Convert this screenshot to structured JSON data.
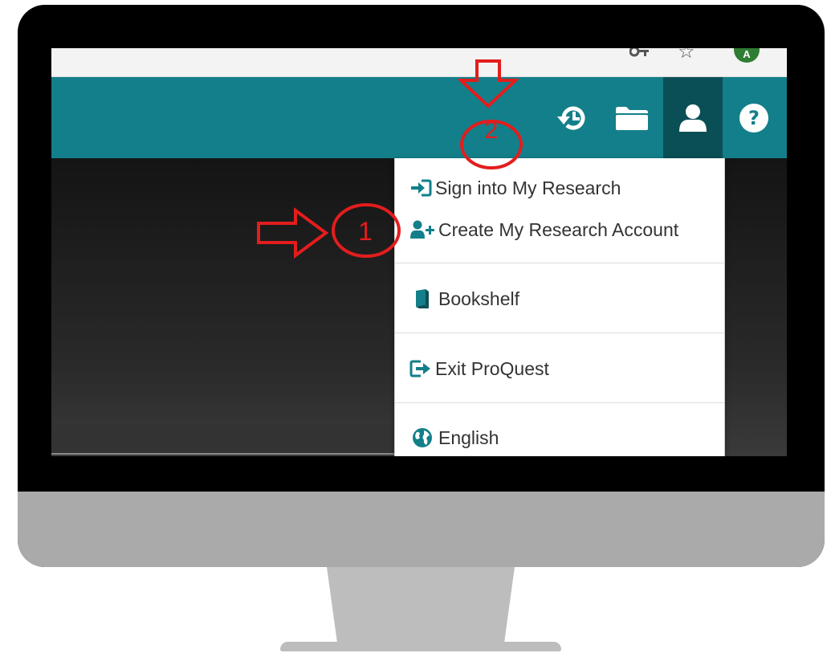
{
  "browser": {
    "avatar_letter": "A",
    "key_icon": "key-icon",
    "star_icon": "star-icon"
  },
  "header": {
    "background_color": "#137f8a",
    "active_button_color": "#0b4f56",
    "buttons": [
      {
        "icon": "history-icon"
      },
      {
        "icon": "folder-icon"
      },
      {
        "icon": "user-icon",
        "active": true
      },
      {
        "icon": "help-icon"
      }
    ]
  },
  "menu": {
    "items": [
      {
        "icon": "sign-in-icon",
        "label": "Sign into My Research"
      },
      {
        "icon": "add-user-icon",
        "label": "Create My Research Account"
      },
      {
        "icon": "book-icon",
        "label": "Bookshelf"
      },
      {
        "icon": "exit-icon",
        "label": "Exit ProQuest"
      },
      {
        "icon": "globe-icon",
        "label": "English"
      }
    ]
  },
  "annotations": {
    "color": "#e31d1d",
    "step1_label": "1",
    "step2_label": "2"
  }
}
